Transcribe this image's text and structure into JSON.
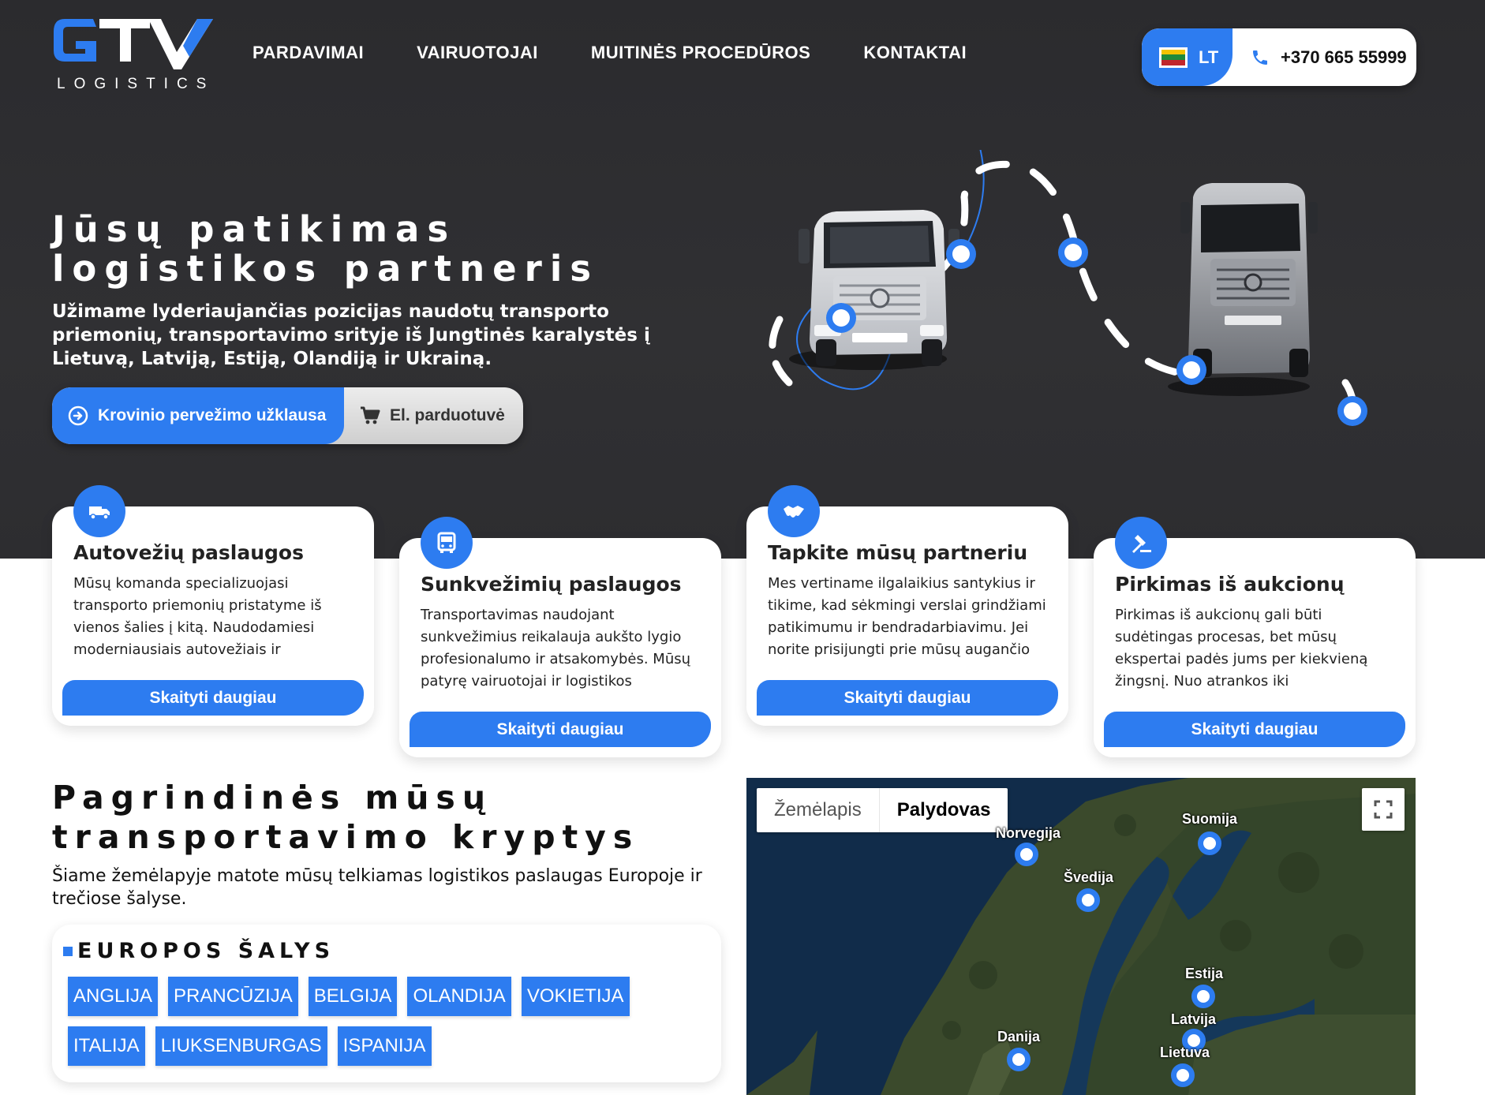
{
  "header": {
    "logo_sub": "LOGISTICS",
    "nav": [
      "PARDAVIMAI",
      "VAIRUOTOJAI",
      "MUITINĖS PROCEDŪROS",
      "KONTAKTAI"
    ],
    "language": "LT",
    "phone": "+370 665 55999",
    "flag_colors": [
      "#f3c300",
      "#1f8a3b",
      "#c1272d"
    ],
    "icons": [
      "lithuania-flag-icon",
      "phone-icon"
    ]
  },
  "hero": {
    "title": "Jūsų patikimas logistikos partneris",
    "description": "Užimame lyderiaujančias pozicijas naudotų transporto priemonių, transportavimo srityje iš Jungtinės karalystės į Lietuvą, Latviją, Estiją, Olandiją ir Ukrainą.",
    "cta_primary": "Krovinio pervežimo užklausa",
    "cta_secondary": "El. parduotuvė",
    "icons": [
      "arrow-circle-icon",
      "cart-icon"
    ]
  },
  "services": [
    {
      "title": "Autovežių paslaugos",
      "text": "Mūsų komanda specializuojasi transporto priemonių pristatyme iš vienos šalies į kitą. Naudodamiesi moderniausiais autovežiais ir",
      "button": "Skaityti daugiau",
      "icon": "car-transporter-icon"
    },
    {
      "title": "Sunkvežimių paslaugos",
      "text": "Transportavimas naudojant sunkvežimius reikalauja aukšto lygio profesionalumo ir atsakomybės. Mūsų patyrę vairuotojai ir logistikos",
      "button": "Skaityti daugiau",
      "icon": "truck-front-icon"
    },
    {
      "title": "Tapkite mūsų partneriu",
      "text": "Mes vertiname ilgalaikius santykius ir tikime, kad sėkmingi verslai grindžiami patikimumu ir bendradarbiavimu. Jei norite prisijungti prie mūsų augančio",
      "button": "Skaityti daugiau",
      "icon": "handshake-icon"
    },
    {
      "title": "Pirkimas iš aukcionų",
      "text": "Pirkimas iš aukcionų gali būti sudėtingas procesas, bet mūsų ekspertai padės jums per kiekvieną žingsnį. Nuo atrankos iki",
      "button": "Skaityti daugiau",
      "icon": "gavel-icon"
    }
  ],
  "routes": {
    "title": "Pagrindinės mūsų transportavimo kryptys",
    "description": "Šiame žemėlapyje matote mūsų telkiamas logistikos paslaugas Europoje ir trečiose šalyse.",
    "europe_heading": "EUROPOS ŠALYS",
    "countries": [
      "ANGLIJA",
      "PRANCŪZIJA",
      "BELGIJA",
      "OLANDIJA",
      "VOKIETIJA",
      "ITALIJA",
      "LIUKSENBURGAS",
      "ISPANIJA"
    ]
  },
  "map": {
    "tab_map": "Žemėlapis",
    "tab_satellite": "Palydovas",
    "active_tab": "Palydovas",
    "pins": [
      {
        "label": "Norvegija"
      },
      {
        "label": "Suomija"
      },
      {
        "label": "Švedija"
      },
      {
        "label": "Estija"
      },
      {
        "label": "Latvija"
      },
      {
        "label": "Danija"
      },
      {
        "label": "Lietuva"
      }
    ]
  },
  "colors": {
    "accent": "#2d7cf0",
    "hero_bg": "#2e2e31"
  }
}
